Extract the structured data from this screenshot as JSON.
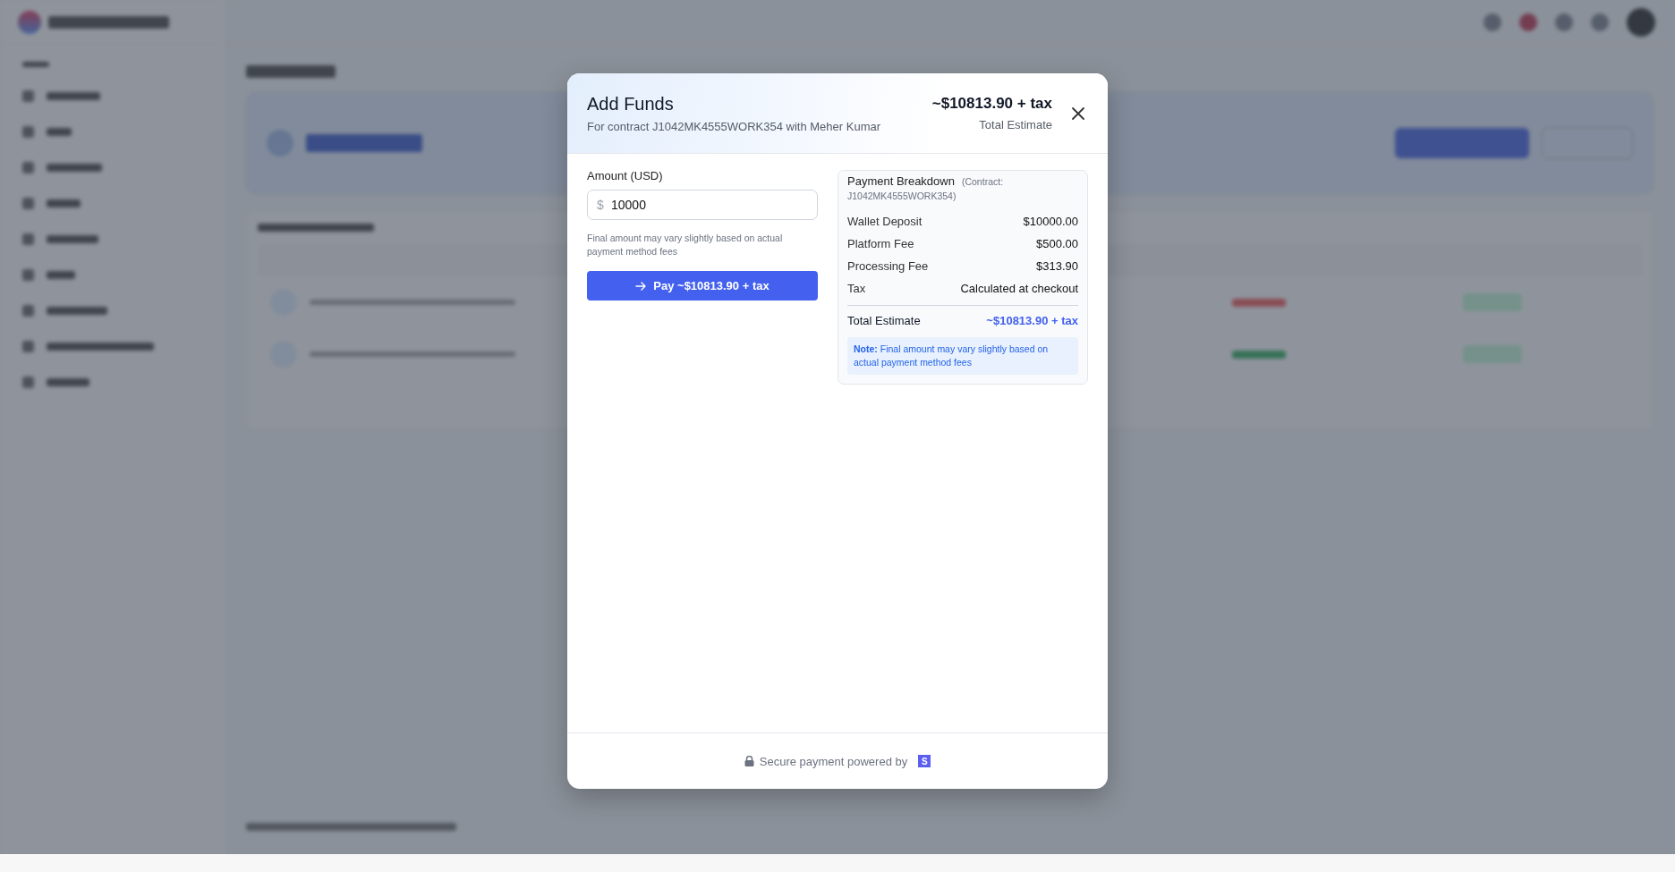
{
  "modal": {
    "title": "Add Funds",
    "subtitle": "For contract J1042MK4555WORK354 with Meher Kumar",
    "estimate": "~$10813.90 + tax",
    "estimate_label": "Total Estimate",
    "amount_field": {
      "label": "Amount (USD)",
      "currency": "$",
      "value": "10000"
    },
    "hint": "Final amount may vary slightly based on actual payment method fees",
    "pay_button": "Pay ~$10813.90 + tax",
    "breakdown": {
      "title": "Payment Breakdown",
      "contract": "(Contract: J1042MK4555WORK354)",
      "rows": [
        {
          "label": "Wallet Deposit",
          "value": "$10000.00"
        },
        {
          "label": "Platform Fee",
          "value": "$500.00"
        },
        {
          "label": "Processing Fee",
          "value": "$313.90"
        },
        {
          "label": "Tax",
          "value": "Calculated at checkout"
        }
      ],
      "total": {
        "label": "Total Estimate",
        "value": "~$10813.90 + tax"
      },
      "note": "**Note:** Final amount may vary slightly based on actual payment method fees"
    },
    "footer": {
      "text": "Secure payment powered by",
      "badge": "S"
    }
  }
}
